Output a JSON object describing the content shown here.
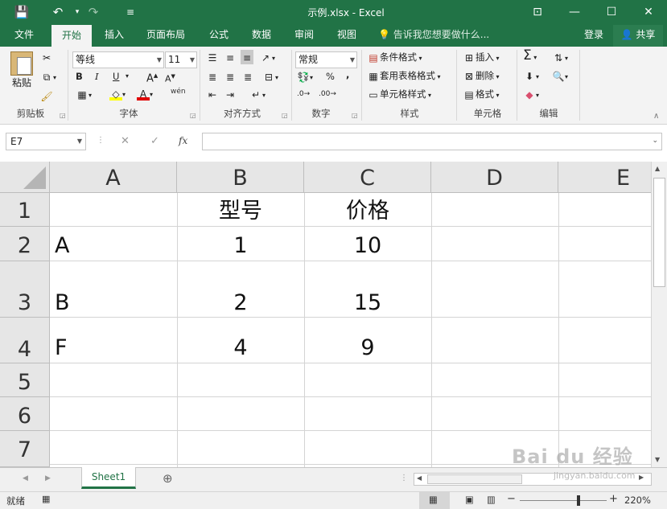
{
  "window": {
    "title": "示例.xlsx - Excel",
    "qa_save": "💾",
    "qa_undo": "↶",
    "qa_redo": "↷",
    "qa_more": "≡",
    "ribbon_display": "⊡",
    "minimize": "—",
    "maximize": "☐",
    "close": "✕"
  },
  "tabs": [
    "文件",
    "开始",
    "插入",
    "页面布局",
    "公式",
    "数据",
    "审阅",
    "视图"
  ],
  "active_tab": "开始",
  "tell_me": "告诉我您想要做什么...",
  "account": {
    "login": "登录",
    "share": "共享"
  },
  "ribbon": {
    "clipboard": {
      "paste": "粘贴",
      "label": "剪贴板"
    },
    "font": {
      "name": "等线",
      "size": "11",
      "bold": "B",
      "italic": "I",
      "underline": "U",
      "grow": "A",
      "shrink": "A",
      "phonetic": "wén",
      "label": "字体"
    },
    "alignment": {
      "label": "对齐方式"
    },
    "number": {
      "format": "常规",
      "percent": "%",
      "comma": ",",
      "label": "数字"
    },
    "styles": {
      "conditional": "条件格式",
      "table": "套用表格格式",
      "cell": "单元格样式",
      "label": "样式"
    },
    "cells": {
      "insert": "插入",
      "delete": "删除",
      "format": "格式",
      "label": "单元格"
    },
    "editing": {
      "sum": "Σ",
      "label": "编辑"
    }
  },
  "formula_bar": {
    "name_box": "E7",
    "cancel": "✕",
    "enter": "✓",
    "fx": "fx",
    "value": ""
  },
  "columns": [
    "A",
    "B",
    "C",
    "D",
    "E"
  ],
  "rows": [
    {
      "num": "1",
      "A": "",
      "B": "型号",
      "C": "价格",
      "D": "",
      "E": ""
    },
    {
      "num": "2",
      "A": "A",
      "B": "1",
      "C": "10",
      "D": "",
      "E": ""
    },
    {
      "num": "3",
      "A": "B",
      "B": "2",
      "C": "15",
      "D": "",
      "E": ""
    },
    {
      "num": "4",
      "A": "F",
      "B": "4",
      "C": "9",
      "D": "",
      "E": ""
    },
    {
      "num": "5",
      "A": "",
      "B": "",
      "C": "",
      "D": "",
      "E": ""
    },
    {
      "num": "6",
      "A": "",
      "B": "",
      "C": "",
      "D": "",
      "E": ""
    },
    {
      "num": "7",
      "A": "",
      "B": "",
      "C": "",
      "D": "",
      "E": ""
    }
  ],
  "sheet": {
    "active": "Sheet1",
    "add": "⊕"
  },
  "status": {
    "ready": "就绪",
    "zoom": "220%"
  },
  "watermark": {
    "brand": "Bai du 经验",
    "url": "jingyan.baidu.com"
  },
  "colors": {
    "accent": "#217346",
    "ribbon": "#f3f3f3",
    "header": "#e6e6e6"
  }
}
